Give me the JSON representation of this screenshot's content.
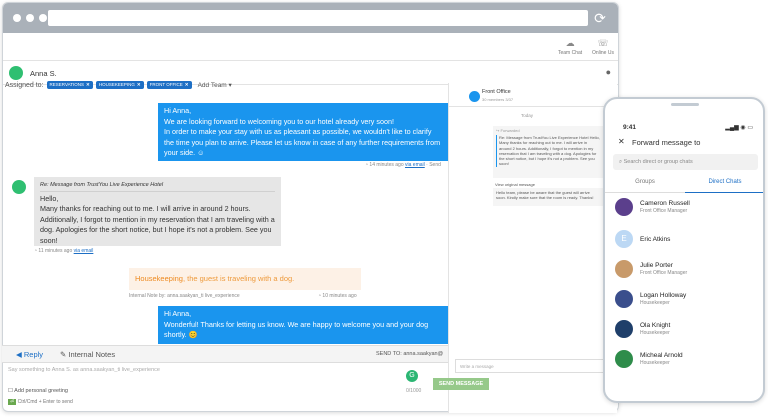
{
  "topbar": {
    "team_chat": "Team Chat",
    "online_us": "Online Us"
  },
  "contact": {
    "name": "Anna S."
  },
  "assigned": {
    "label": "Assigned to:",
    "tags": [
      "RESERVATIONS",
      "HOUSEKEEPING",
      "FRONT OFFICE"
    ],
    "add_team": "Add Team"
  },
  "messages": {
    "m1": {
      "text": "Hi Anna,\nWe are looking forward to welcoming you to our hotel already very soon!\nIn order to make your stay with us as pleasant as possible, we wouldn't like to clarify the time you plan to arrive. Please let us know in case of any further requirements from your side. ☺",
      "time": "14 minutes ago",
      "via": "via email",
      "send": "Send"
    },
    "m2": {
      "subject": "Re: Message from TrustYou Live Experience Hotel",
      "text": "Hello,\nMany thanks for reaching out to me. I will arrive in around 2 hours. Additionally, I forgot to mention in my reservation that I am traveling with a dog. Apologies for the short notice, but I hope it's not a problem. See you soon!",
      "time": "11 minutes ago",
      "via": "via email"
    },
    "note": {
      "team": "Housekeeping",
      "text": ", the guest is traveling with a dog.",
      "meta": "Internal Note by: anna.saakyan_ti live_experience",
      "time": "10 minutes ago"
    },
    "m3": {
      "text": "Hi Anna,\nWonderful! Thanks for letting us know. We are happy to welcome you and your dog shortly. 😊"
    }
  },
  "composer": {
    "reply": "Reply",
    "internal_notes": "Internal Notes",
    "send_to": "SEND TO:",
    "send_to_value": "anna.saakyan@",
    "placeholder": "Say something to Anna S. as anna.saakyan_ti live_experience",
    "greeting": "Add personal greeting",
    "counter": "0/1000",
    "hint": "Ctrl/Cmd + Enter to send",
    "send": "SEND MESSAGE"
  },
  "side": {
    "title": "Front Office",
    "sub": "30 members 3/37",
    "today": "Today",
    "fwd": "Forwarded",
    "fwd_text": "Re: Message from TrustYou Live Experience Hotel Hello, Many thanks for reaching out to me. I will arrive in around 2 hours. Additionally, I forgot to mention in my reservation that I am traveling with a dog. Apologies for the short notice, but I hope it's not a problem. See you soon!",
    "view": "View original message",
    "reply": "Hello team, please be aware that the guest will arrive soon. Kindly make sure that the room is ready. Thanks!",
    "write": "Write a message"
  },
  "phone": {
    "time": "9:41",
    "title": "Forward message to",
    "search": "Search direct or group chats",
    "tab_groups": "Groups",
    "tab_direct": "Direct Chats",
    "contacts": [
      {
        "name": "Cameron Russell",
        "role": "Front Office Manager",
        "color": "#5b3f8c"
      },
      {
        "name": "Eric Atkins",
        "role": "",
        "color": "#bcd8f4",
        "initial": "E"
      },
      {
        "name": "Julie Porter",
        "role": "Front Office Manager",
        "color": "#c89a6a"
      },
      {
        "name": "Logan Holloway",
        "role": "Housekeeper",
        "color": "#3a4e8c"
      },
      {
        "name": "Ola Knight",
        "role": "Housekeeper",
        "color": "#1f3f6a"
      },
      {
        "name": "Micheal Arnold",
        "role": "Housekeeper",
        "color": "#2e8c4a"
      }
    ]
  }
}
